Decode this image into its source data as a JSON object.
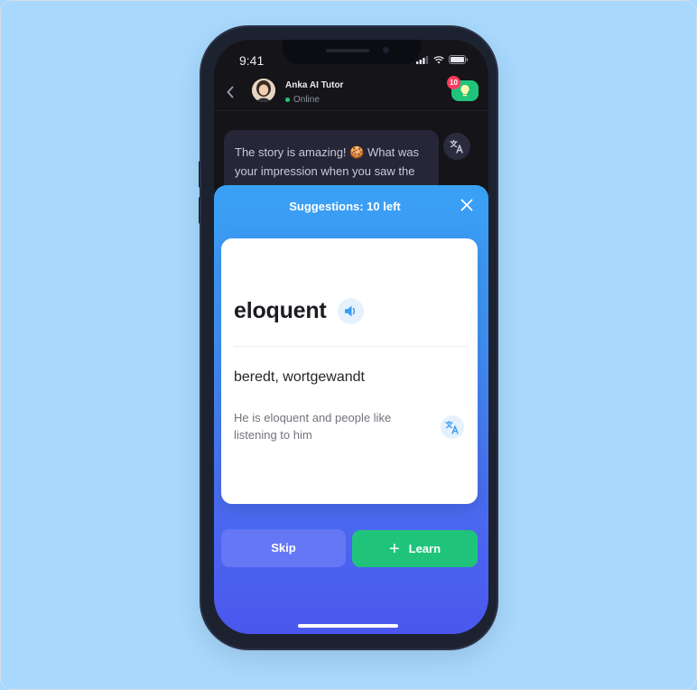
{
  "status_bar": {
    "time": "9:41"
  },
  "header": {
    "tutor_name": "Anka AI Tutor",
    "status": "Online",
    "hint_badge_count": "10"
  },
  "chat": {
    "message": "The story is amazing! 🍪 What was your impression when you saw the"
  },
  "sheet": {
    "title": "Suggestions: 10 left",
    "card": {
      "word": "eloquent",
      "translation": "beredt, wortgewandt",
      "example": "He is eloquent and people like listening to him"
    },
    "skip_label": "Skip",
    "learn_label": "Learn"
  },
  "colors": {
    "background": "#a8d8fd",
    "accent_green": "#1fc47a",
    "sheet_top": "#3aa1f5",
    "sheet_bottom": "#4b57ee",
    "badge_red": "#ff3b5c"
  },
  "icons": [
    "back-chevron-icon",
    "lightbulb-icon",
    "translate-icon",
    "speaker-icon",
    "close-icon",
    "plus-icon",
    "signal-icon",
    "wifi-icon",
    "battery-icon"
  ]
}
